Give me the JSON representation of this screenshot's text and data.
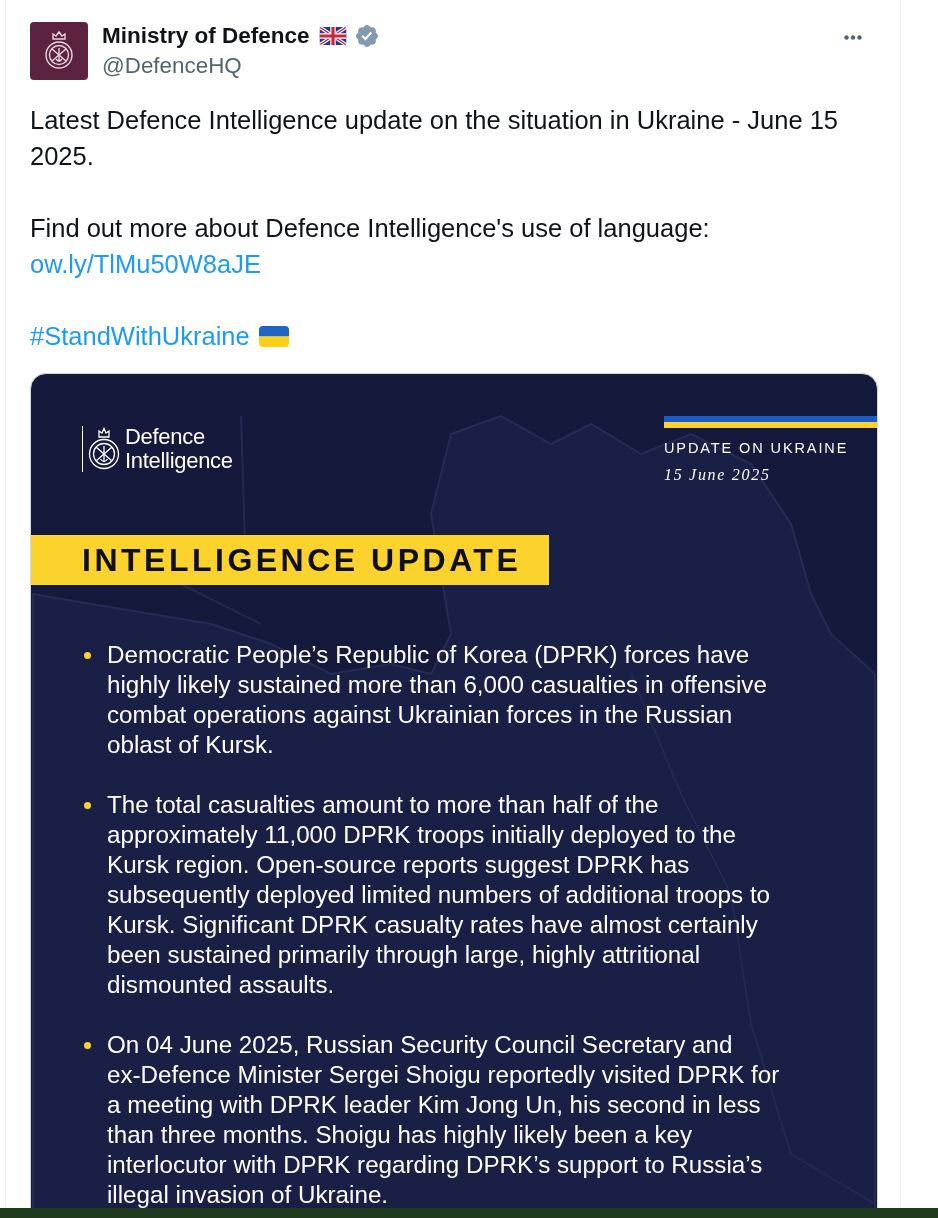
{
  "post": {
    "author": {
      "name": "Ministry of Defence",
      "handle": "@DefenceHQ",
      "verified": true
    },
    "paragraphs": [
      [
        {
          "kind": "text",
          "text": "Latest Defence Intelligence update on the situation in Ukraine - June 15 2025."
        }
      ],
      [
        {
          "kind": "text",
          "text": "Find out more about Defence Intelligence's use of language:"
        },
        {
          "kind": "link",
          "text": "ow.ly/TlMu50W8aJE"
        }
      ],
      [
        {
          "kind": "hashtag",
          "text": "#StandWithUkraine"
        }
      ]
    ]
  },
  "media": {
    "logo_text": "Defence Intelligence",
    "label": "UPDATE ON UKRAINE",
    "date": "15 June 2025",
    "banner": "INTELLIGENCE UPDATE",
    "bullets": [
      "Democratic People’s Republic of Korea (DPRK) forces have highly likely sustained more than 6,000 casualties in offensive combat operations against Ukrainian forces in the Russian oblast of Kursk.",
      "The total casualties amount to more than half of the approximately 11,000 DPRK troops initially deployed to the Kursk region. Open-source reports suggest DPRK has subsequently deployed limited numbers of additional troops to Kursk. Significant DPRK casualty rates have almost certainly been sustained primarily through large, highly attritional dismounted assaults.",
      "On 04 June 2025, Russian Security Council Secretary and ex-Defence Minister Sergei Shoigu reportedly visited DPRK for a meeting with DPRK leader Kim Jong Un, his second in less than three months. Shoigu has highly likely been a key interlocutor with DPRK regarding DPRK’s support to Russia’s illegal invasion of Ukraine."
    ]
  }
}
